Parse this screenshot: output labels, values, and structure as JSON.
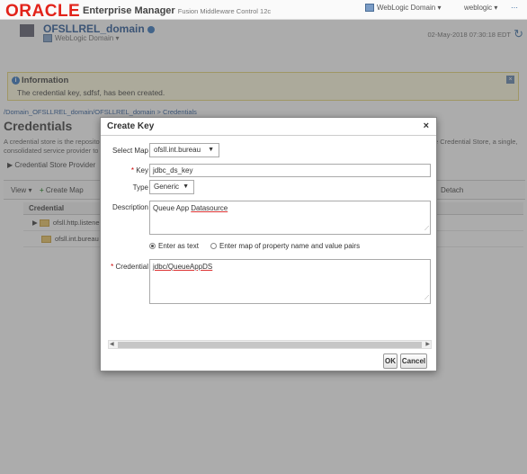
{
  "header": {
    "logo": "ORACLE",
    "product": "Enterprise Manager",
    "product_sub": "Fusion Middleware Control 12c",
    "domain_menu": "WebLogic Domain",
    "user_menu": "weblogic",
    "more": "⋯"
  },
  "domain": {
    "title": "OFSLLREL_domain",
    "subtitle": "WebLogic Domain",
    "timestamp": "02-May-2018 07:30:18 EDT"
  },
  "info": {
    "title": "Information",
    "message": "The credential key, sdfsf, has been created."
  },
  "page": {
    "breadcrumb": "/Domain_OFSLLREL_domain/OFSLLREL_domain > Credentials",
    "title": "Credentials",
    "description_left": "A credential store is the repositor consolidated service provider to s",
    "description_right": "e Credential Store, a single,",
    "credential_store_provider": "Credential Store Provider",
    "toolbar": {
      "view": "View",
      "create_map": "Create Map",
      "detach": "Detach"
    },
    "table": {
      "column": "Credential",
      "rows": [
        "ofsll.http.listener.ji",
        "ofsll.int.bureau"
      ]
    }
  },
  "dialog": {
    "title": "Create Key",
    "close": "×",
    "select_map_label": "Select Map",
    "select_map_value": "ofsll.int.bureau",
    "key_label": "Key",
    "key_value": "jdbc_ds_key",
    "type_label": "Type",
    "type_value": "Generic",
    "description_label": "Description",
    "description_value_prefix": "Queue App ",
    "description_value_underlined": "Datasource",
    "radio_text": "Enter as text",
    "radio_map": "Enter map of property name and value pairs",
    "credential_label": "Credential",
    "credential_value": "jdbc/QueueAppDS",
    "ok": "OK",
    "cancel": "Cancel"
  }
}
